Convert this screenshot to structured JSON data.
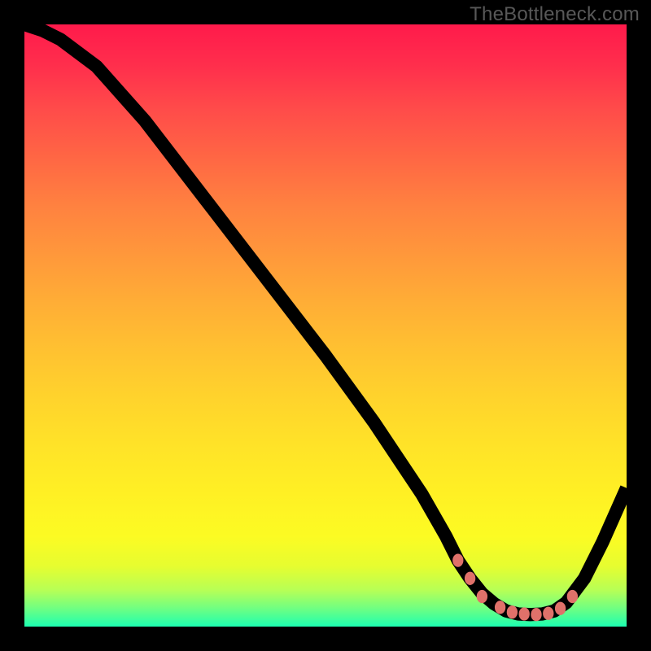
{
  "watermark": "TheBottleneck.com",
  "chart_data": {
    "type": "line",
    "title": "",
    "xlabel": "",
    "ylabel": "",
    "xlim": [
      0,
      100
    ],
    "ylim": [
      0,
      100
    ],
    "grid": false,
    "legend": false,
    "background": {
      "type": "vertical-gradient",
      "stops": [
        {
          "pos": 0,
          "color": "#ff1a4b"
        },
        {
          "pos": 50,
          "color": "#ffc131"
        },
        {
          "pos": 85,
          "color": "#fcfb23"
        },
        {
          "pos": 100,
          "color": "#1cffb1"
        }
      ]
    },
    "series": [
      {
        "name": "bottleneck-curve",
        "x": [
          0,
          3,
          6,
          12,
          20,
          30,
          40,
          50,
          58,
          62,
          66,
          70,
          72,
          74,
          76,
          78,
          80,
          82,
          84,
          86,
          88,
          90,
          93,
          96,
          100
        ],
        "values": [
          100,
          99,
          97.5,
          93,
          84,
          71,
          58,
          45,
          34,
          28,
          22,
          15,
          11,
          8,
          5.5,
          3.8,
          2.6,
          2.1,
          2.0,
          2.1,
          2.6,
          4,
          8,
          14,
          23
        ]
      }
    ],
    "markers": {
      "name": "valley-markers",
      "color": "#e0716a",
      "x": [
        72,
        74,
        76,
        79,
        81,
        83,
        85,
        87,
        89,
        91
      ],
      "values": [
        11,
        8,
        5,
        3.2,
        2.4,
        2.1,
        2.0,
        2.2,
        3.0,
        5
      ]
    }
  }
}
